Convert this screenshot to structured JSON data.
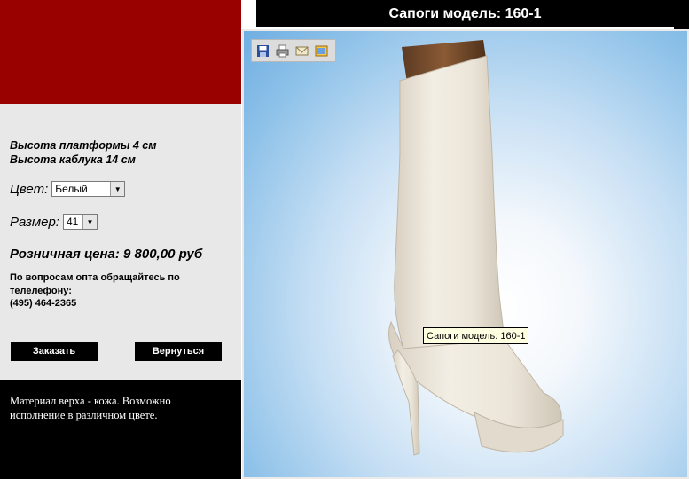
{
  "page": {
    "title": "Сапоги модель: 160-1"
  },
  "details": {
    "platform_height": "Высота платформы 4 см",
    "heel_height": "Высота каблука 14 см",
    "color_label": "Цвет:",
    "color_value": "Белый",
    "size_label": "Размер:",
    "size_value": "41",
    "price": "Розничная цена: 9 800,00 руб",
    "wholesale_note": "По вопросам опта обращайтесь по телелефону:",
    "phone": "(495) 464-2365"
  },
  "buttons": {
    "order": "Заказать",
    "back": "Вернуться"
  },
  "description": "Материал верха - кожа. Возможно исполнение в различном цвете.",
  "image": {
    "tooltip": "Сапоги модель: 160-1"
  },
  "toolbar": {
    "icons": [
      "save-icon",
      "print-icon",
      "email-icon",
      "gallery-icon"
    ]
  },
  "colors": {
    "brand_red": "#990000",
    "panel_gray": "#e8e8e8",
    "black": "#000000"
  }
}
